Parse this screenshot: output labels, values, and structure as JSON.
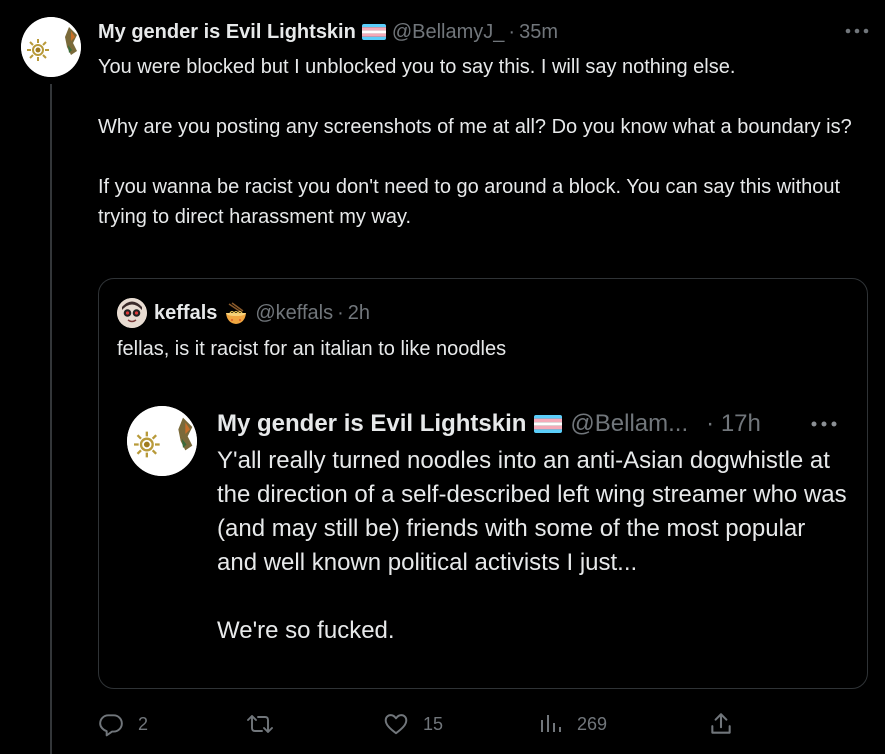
{
  "tweet": {
    "display_name": "My gender is Evil Lightskin",
    "flag_icon": "transgender-flag-icon",
    "handle": "@BellamyJ_",
    "separator": "·",
    "time": "35m",
    "paragraphs": [
      "You were blocked but I unblocked you to say this. I will say nothing else.",
      "Why are you posting any screenshots of me at all? Do you know what a boundary is?",
      "If you wanna be racist you don't need to go around a block. You can say this without trying to direct harassment my way."
    ]
  },
  "quote": {
    "display_name": "keffals",
    "emoji_icon": "noodle-bowl-icon",
    "handle": "@keffals",
    "separator": "·",
    "time": "2h",
    "text": "fellas, is it racist for an italian to like noodles",
    "embedded": {
      "display_name": "My gender is Evil Lightskin",
      "flag_icon": "transgender-flag-icon",
      "handle": "@Bellam...",
      "separator": "·",
      "time": "17h",
      "paragraphs": [
        "Y'all really turned noodles into an anti-Asian dogwhistle at the direction of a self-described left wing streamer who was (and may still be) friends with some of the most popular and well known political activists I just...",
        "We're so fucked."
      ]
    }
  },
  "actions": {
    "reply": {
      "icon": "reply-icon",
      "count": "2"
    },
    "retweet": {
      "icon": "retweet-icon",
      "count": ""
    },
    "like": {
      "icon": "heart-icon",
      "count": "15"
    },
    "views": {
      "icon": "views-icon",
      "count": "269"
    },
    "share": {
      "icon": "share-icon"
    }
  },
  "colors": {
    "background": "#000000",
    "text": "#e7e9ea",
    "muted": "#71767b",
    "border": "#2f3336"
  }
}
